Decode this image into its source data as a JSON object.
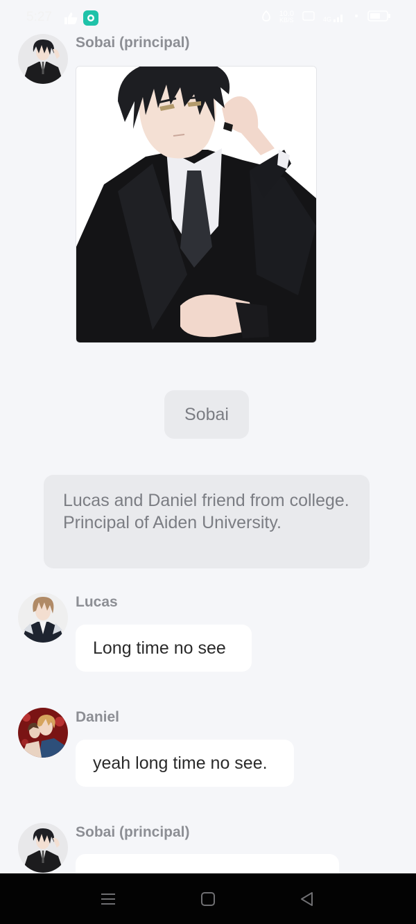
{
  "status_bar": {
    "time": "5:27",
    "net_speed_value": "10.0",
    "net_speed_unit": "KB/S",
    "signal_label": "4G"
  },
  "messages": [
    {
      "sender": "Sobai (principal)",
      "type": "image",
      "avatar_icon": "sobai-avatar"
    },
    {
      "type": "system_title",
      "text": "Sobai"
    },
    {
      "type": "system_description",
      "text": "Lucas and Daniel friend from college. Principal of Aiden University."
    },
    {
      "sender": "Lucas",
      "type": "text",
      "text": "Long time no see",
      "avatar_icon": "lucas-avatar"
    },
    {
      "sender": "Daniel",
      "type": "text",
      "text": "yeah long time no see.",
      "avatar_icon": "daniel-avatar"
    },
    {
      "sender": "Sobai (principal)",
      "type": "text_partial",
      "text": "",
      "avatar_icon": "sobai-avatar"
    }
  ],
  "colors": {
    "background": "#f5f6f9",
    "bubble": "#ffffff",
    "system_bubble": "#e9eaed",
    "name_text": "#8c8e94",
    "message_text": "#2a2a2a",
    "nav_bar": "#030303"
  },
  "nav_bar": {
    "icons": [
      "menu-icon",
      "home-icon",
      "back-icon"
    ]
  }
}
